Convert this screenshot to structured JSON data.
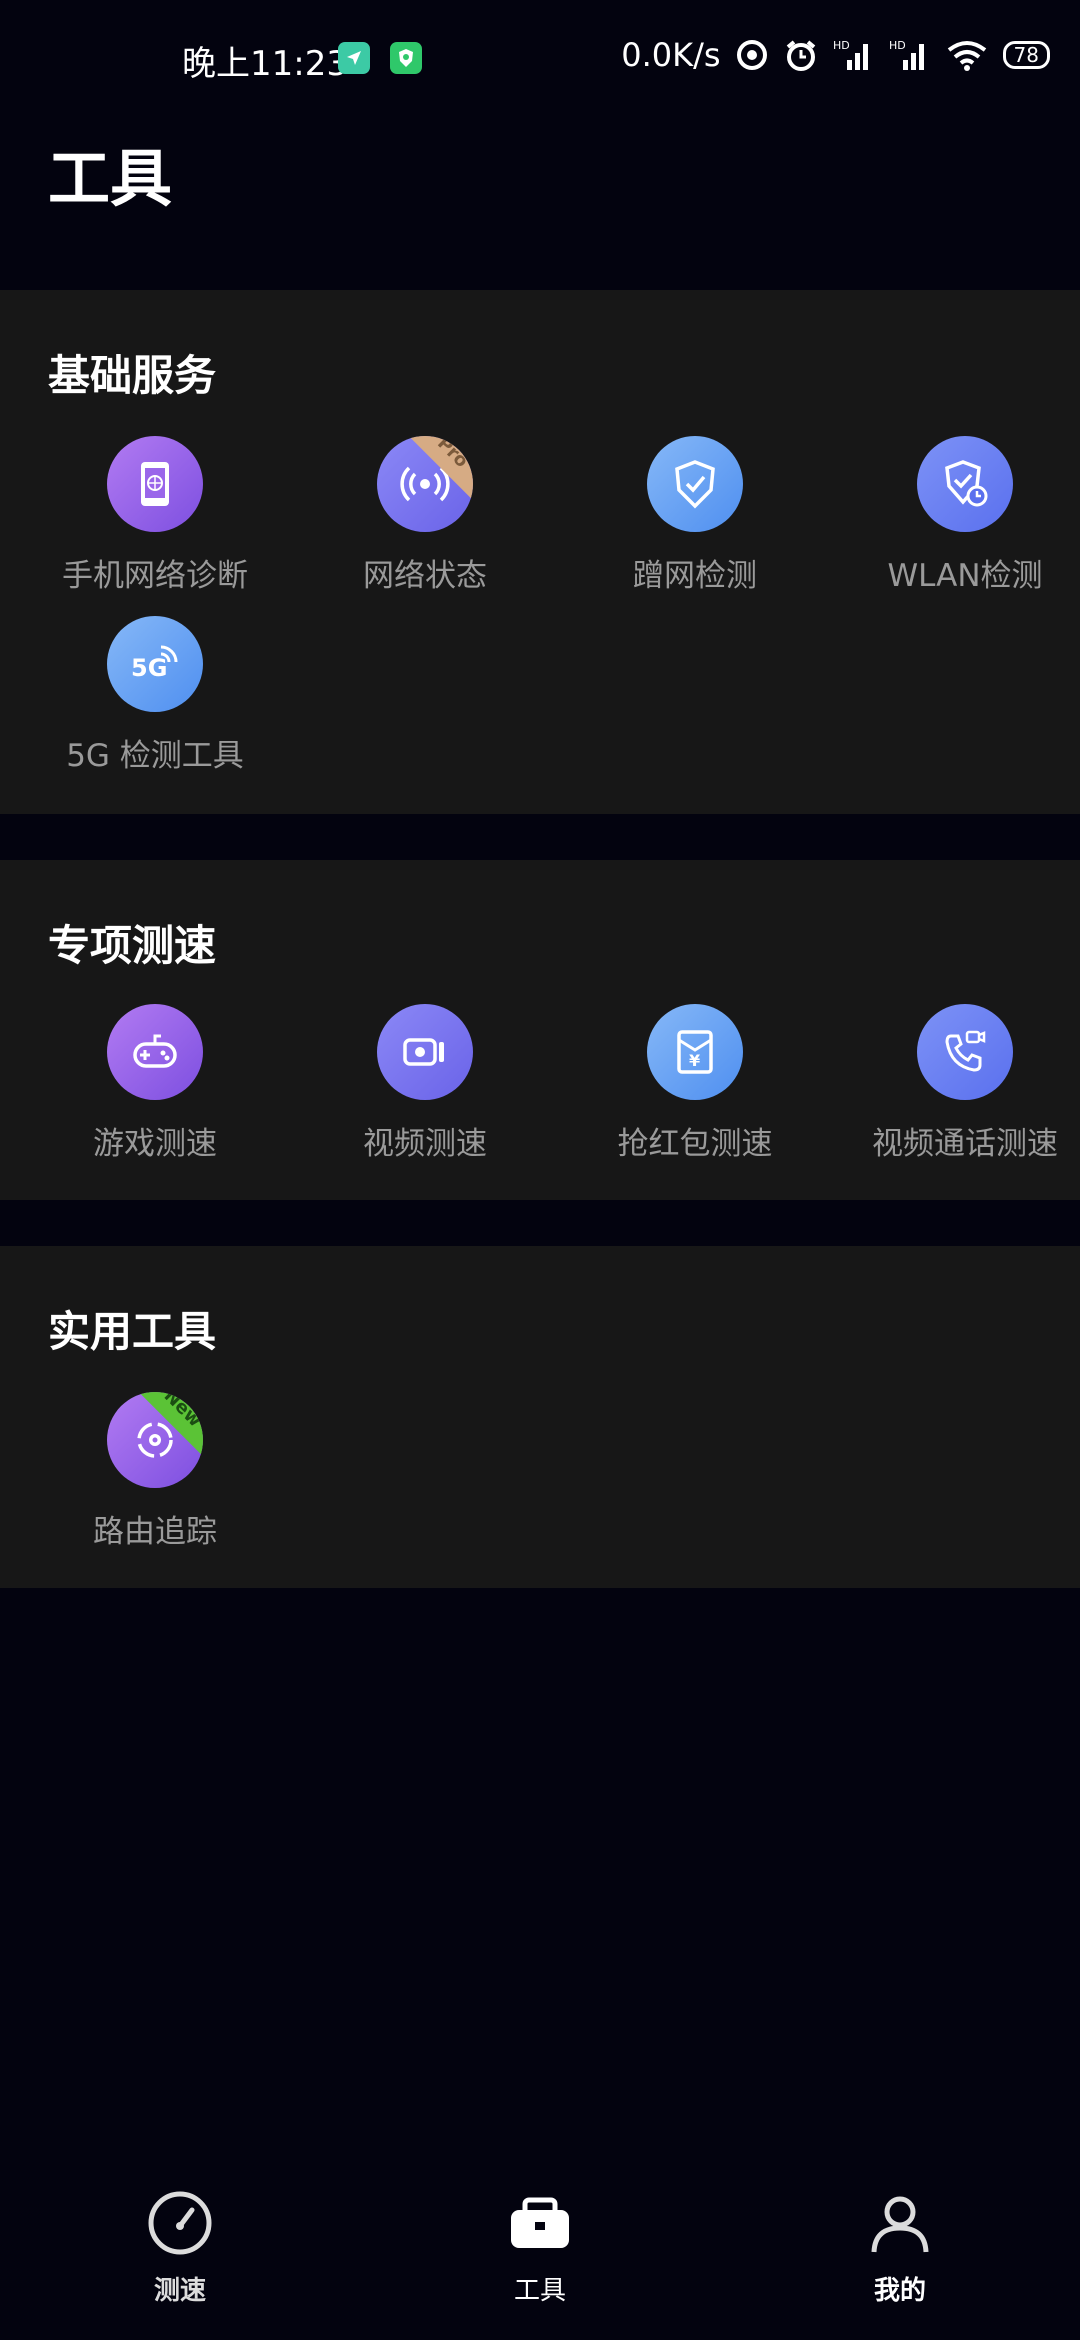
{
  "status_bar": {
    "time": "晚上11:23",
    "net_speed": "0.0K/s",
    "battery": "78",
    "icons": [
      "location-arrow-icon",
      "shield-app-icon",
      "hotspot-icon",
      "alarm-icon",
      "signal-hd-icon",
      "signal-hd-icon",
      "wifi-icon",
      "battery-icon"
    ]
  },
  "page": {
    "title": "工具"
  },
  "sections": {
    "basic": {
      "title": "基础服务",
      "items": [
        "手机网络诊断",
        "网络状态",
        "蹭网检测",
        "WLAN检测",
        "5G 检测工具"
      ],
      "badge": "Pro"
    },
    "speed": {
      "title": "专项测速",
      "items": [
        "游戏测速",
        "视频测速",
        "抢红包测速",
        "视频通话测速"
      ]
    },
    "utils": {
      "title": "实用工具",
      "items": [
        "路由追踪"
      ],
      "badge": "New"
    }
  },
  "icon_text": {
    "five_g": "5G",
    "yuan": "¥"
  },
  "nav": {
    "items": [
      "测速",
      "工具",
      "我的"
    ],
    "active": "工具",
    "active_color": "#ffffff",
    "inactive_color": "#dcdcdc"
  }
}
